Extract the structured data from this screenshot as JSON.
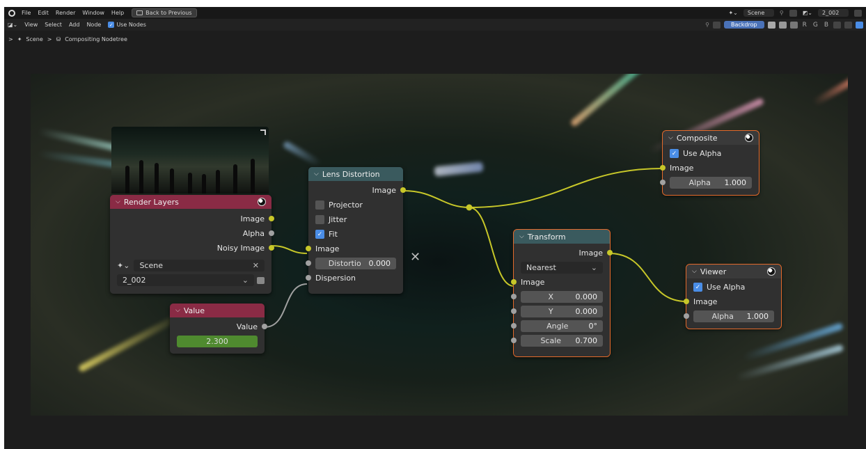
{
  "menu": {
    "items": [
      "File",
      "Edit",
      "Render",
      "Window",
      "Help"
    ],
    "back_button": "Back to Previous",
    "scene_name": "Scene",
    "view_layer": "2_002"
  },
  "header": {
    "items": [
      "View",
      "Select",
      "Add",
      "Node"
    ],
    "use_nodes_label": "Use Nodes",
    "backdrop_label": "Backdrop",
    "channels": [
      "R",
      "G",
      "B"
    ]
  },
  "breadcrumb": {
    "scene": "Scene",
    "separator": ">",
    "nodetree": "Compositing Nodetree"
  },
  "nodes": {
    "render_layers": {
      "title": "Render Layers",
      "outputs": [
        "Image",
        "Alpha",
        "Noisy Image"
      ],
      "scene": "Scene",
      "layer": "2_002",
      "header_color": "#8a2b45"
    },
    "value": {
      "title": "Value",
      "output": "Value",
      "number": "2.300",
      "header_color": "#8a2b45"
    },
    "lens_distortion": {
      "title": "Lens Distortion",
      "output": "Image",
      "projector": "Projector",
      "jitter": "Jitter",
      "fit": "Fit",
      "input_image": "Image",
      "distortion_label": "Distortio",
      "distortion_value": "0.000",
      "dispersion": "Dispersion",
      "header_color": "#3a5a5e"
    },
    "transform": {
      "title": "Transform",
      "output": "Image",
      "filter": "Nearest",
      "input_image": "Image",
      "fields": [
        {
          "label": "X",
          "value": "0.000"
        },
        {
          "label": "Y",
          "value": "0.000"
        },
        {
          "label": "Angle",
          "value": "0°"
        },
        {
          "label": "Scale",
          "value": "0.700"
        }
      ],
      "header_color": "#3a5a5e"
    },
    "composite": {
      "title": "Composite",
      "use_alpha": "Use Alpha",
      "input_image": "Image",
      "alpha_label": "Alpha",
      "alpha_value": "1.000",
      "header_color": "#5e2a2a"
    },
    "viewer": {
      "title": "Viewer",
      "use_alpha": "Use Alpha",
      "input_image": "Image",
      "alpha_label": "Alpha",
      "alpha_value": "1.000",
      "header_color": "#5e2a2a"
    }
  },
  "colors": {
    "link_image": "#c7c729",
    "link_value": "#a1a1a1",
    "selected_outline": "#e46a2b",
    "value_field": "#4f8a2f"
  }
}
